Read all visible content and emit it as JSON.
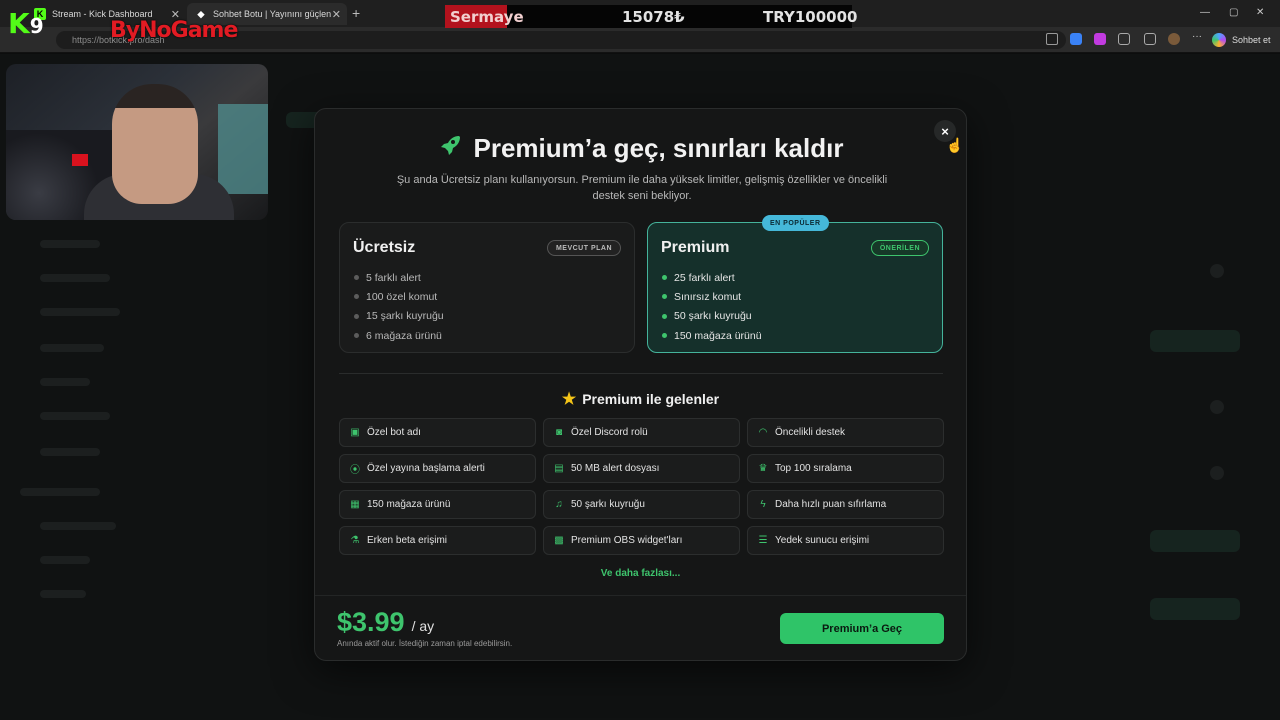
{
  "browser": {
    "tabs": [
      {
        "label": "Stream - Kick Dashboard"
      },
      {
        "label": "Sohbet Botu | Yayınını güçlendirme"
      }
    ],
    "url": "https://botkick.pro/dash",
    "profile_label": "Sohbet et"
  },
  "overlay": {
    "ticker_label": "Sermaye",
    "ticker_value": "15078₺",
    "ticker_target": "TRY100000",
    "logo_k9": "K",
    "logo_k9_num": "9",
    "logo_bynogame": "ByNoGame"
  },
  "modal": {
    "title": "Premium’a geç, sınırları kaldır",
    "subtitle": "Şu anda Ücretsiz planı kullanıyorsun. Premium ile daha yüksek limitler, gelişmiş özellikler ve öncelikli destek seni bekliyor.",
    "close_glyph": "×",
    "plans": {
      "free": {
        "name": "Ücretsiz",
        "pill": "MEVCUT PLAN",
        "features": [
          "5 farklı alert",
          "100 özel komut",
          "15 şarkı kuyruğu",
          "6 mağaza ürünü"
        ]
      },
      "premium": {
        "name": "Premium",
        "top_badge": "EN POPÜLER",
        "pill": "ÖNERİLEN",
        "features": [
          "25 farklı alert",
          "Sınırsız komut",
          "50 şarkı kuyruğu",
          "150 mağaza ürünü"
        ]
      }
    },
    "perks_title": "Premium ile gelenler",
    "perks": [
      {
        "label": "Özel bot adı",
        "icon": "robot-icon"
      },
      {
        "label": "Özel Discord rolü",
        "icon": "discord-icon"
      },
      {
        "label": "Öncelikli destek",
        "icon": "headset-icon"
      },
      {
        "label": "Özel yayına başlama alerti",
        "icon": "broadcast-icon"
      },
      {
        "label": "50 MB alert dosyası",
        "icon": "file-icon"
      },
      {
        "label": "Top 100 sıralama",
        "icon": "trophy-icon"
      },
      {
        "label": "150 mağaza ürünü",
        "icon": "store-icon"
      },
      {
        "label": "50 şarkı kuyruğu",
        "icon": "music-icon"
      },
      {
        "label": "Daha hızlı puan sıfırlama",
        "icon": "bolt-icon"
      },
      {
        "label": "Erken beta erişimi",
        "icon": "flask-icon"
      },
      {
        "label": "Premium OBS widget'ları",
        "icon": "grid-icon"
      },
      {
        "label": "Yedek sunucu erişimi",
        "icon": "server-icon"
      }
    ],
    "more_link": "Ve daha fazlası...",
    "price": "$3.99",
    "price_period": "/ ay",
    "price_note": "Anında aktif olur. İstediğin zaman iptal edebilirsin.",
    "cta_label": "Premium’a Geç"
  },
  "colors": {
    "accent": "#2fc468",
    "badge": "#45b8d9",
    "star": "#f5c518"
  }
}
